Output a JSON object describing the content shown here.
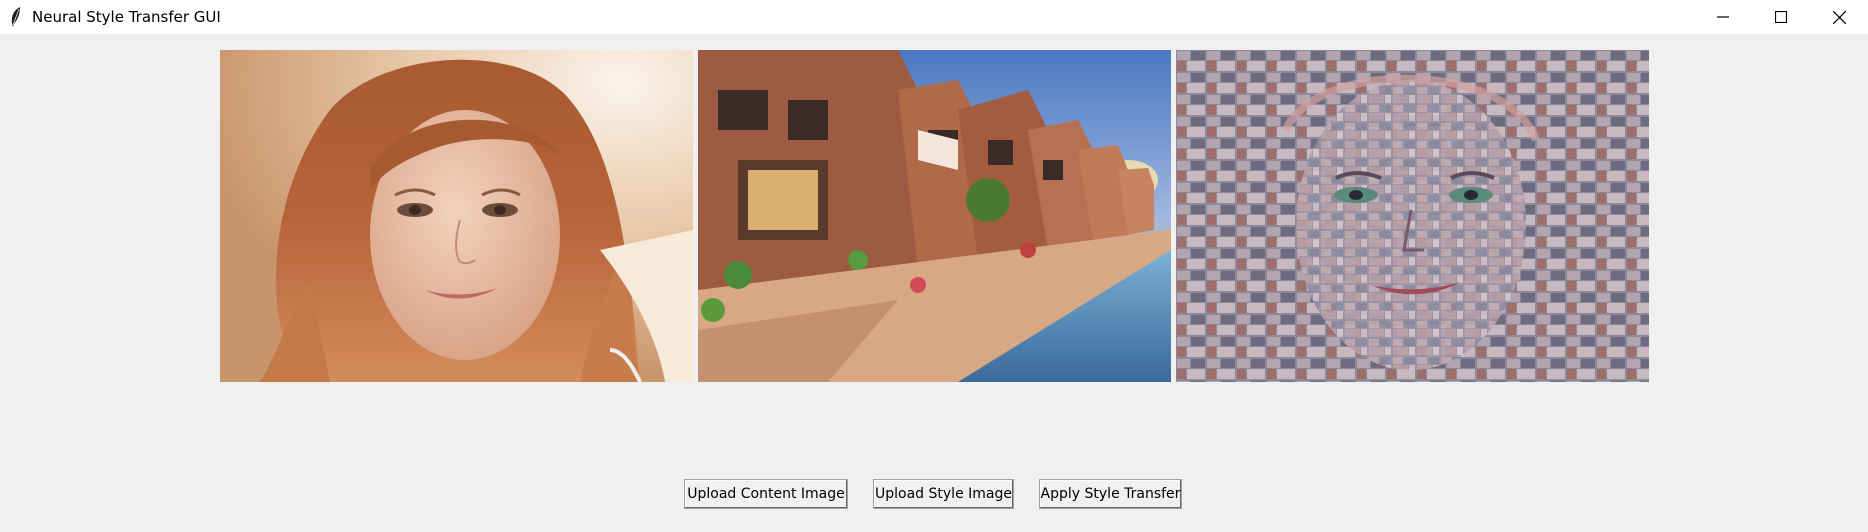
{
  "window": {
    "title": "Neural Style Transfer GUI",
    "icon": "feather-icon"
  },
  "images": {
    "content": {
      "description_name": "content-image"
    },
    "style": {
      "description_name": "style-image"
    },
    "result": {
      "description_name": "stylized-result-image"
    }
  },
  "buttons": {
    "upload_content": "Upload Content Image",
    "upload_style": "Upload Style Image",
    "apply": "Apply Style Transfer"
  },
  "colors": {
    "background": "#f0f0f0",
    "titlebar": "#ffffff"
  }
}
